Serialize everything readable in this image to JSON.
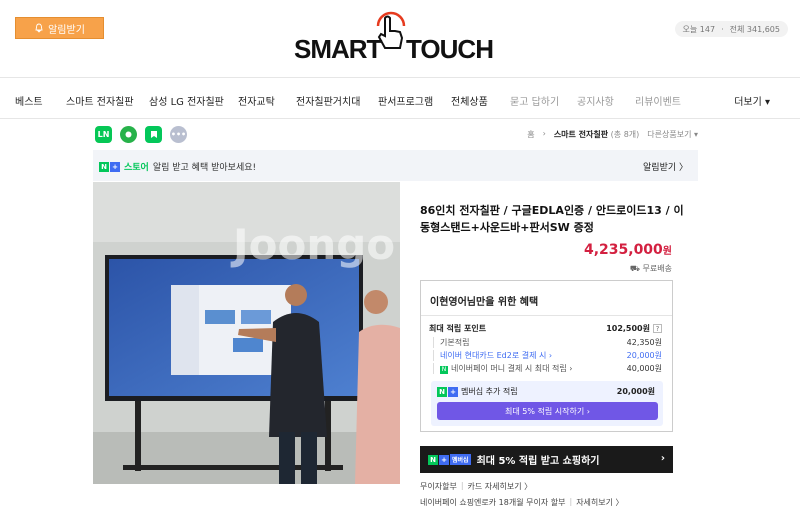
{
  "header": {
    "alarm_button": "알림받기",
    "logo_left": "SMART",
    "logo_right": "TOUCH",
    "visits": {
      "today_label": "오늘",
      "today": "147",
      "total_label": "전체",
      "total": "341,605"
    }
  },
  "nav": {
    "items": [
      {
        "label": "베스트",
        "muted": false
      },
      {
        "label": "스마트 전자칠판",
        "muted": false
      },
      {
        "label": "삼성 LG 전자칠판",
        "muted": false
      },
      {
        "label": "전자교탁",
        "muted": false
      },
      {
        "label": "전자칠판거치대",
        "muted": false
      },
      {
        "label": "판서프로그램",
        "muted": false
      },
      {
        "label": "전체상품",
        "muted": false
      },
      {
        "label": "묻고 답하기",
        "muted": true
      },
      {
        "label": "공지사항",
        "muted": true
      },
      {
        "label": "리뷰이벤트",
        "muted": true
      }
    ],
    "more": "더보기 ▾"
  },
  "share": {
    "icons": [
      "line-share-icon",
      "kakao-story-icon",
      "naver-blog-icon",
      "more-share-icon"
    ],
    "colors": {
      "line": "#06c755",
      "kakao": "#27b24a",
      "blog": "#03c75a",
      "more": "#b9bfd0"
    }
  },
  "breadcrumb": {
    "home": "홈",
    "current": "스마트 전자칠판",
    "count": "(총 8개)",
    "next": "다른상품보기 ▾"
  },
  "store_banner": {
    "store_label": "스토어",
    "text": "알림 받고 혜택 받아보세요!",
    "alarm": "알림받기 〉"
  },
  "product": {
    "title": "86인치 전자칠판 / 구글EDLA인증 / 안드로이드13 / 이동형스탠드+사운드바+판서SW 증정",
    "price": "4,235,000",
    "price_unit": "원",
    "shipping": "무료배송",
    "watermark": "Joongo"
  },
  "benefit": {
    "heading": "이현영어님만을 위한 혜택",
    "max_points_label": "최대 적립 포인트",
    "max_points_value": "102,500원",
    "rows": [
      {
        "label": "기본적립",
        "value": "42,350원",
        "blue": false
      },
      {
        "label": "네이버 현대카드 Ed2로 결제 시 ›",
        "value": "20,000원",
        "blue": true
      },
      {
        "label": "네이버페이 머니 결제 시 최대 적립 ›",
        "value": "40,000원",
        "blue": false
      }
    ],
    "membership_label": "멤버십 추가 적립",
    "membership_value": "20,000원",
    "membership_button": "최대 5% 적립 시작하기 ›"
  },
  "promo": {
    "badge": "멤버십",
    "text": "최대 5% 적립 받고 쇼핑하기",
    "arrow": "›"
  },
  "footer": {
    "line1": [
      "무이자할부",
      "카드 자세히보기 〉"
    ],
    "line2": [
      "네이버페이 쇼핑엔로카 18개월 무이자 할부",
      "자세히보기 〉"
    ]
  }
}
